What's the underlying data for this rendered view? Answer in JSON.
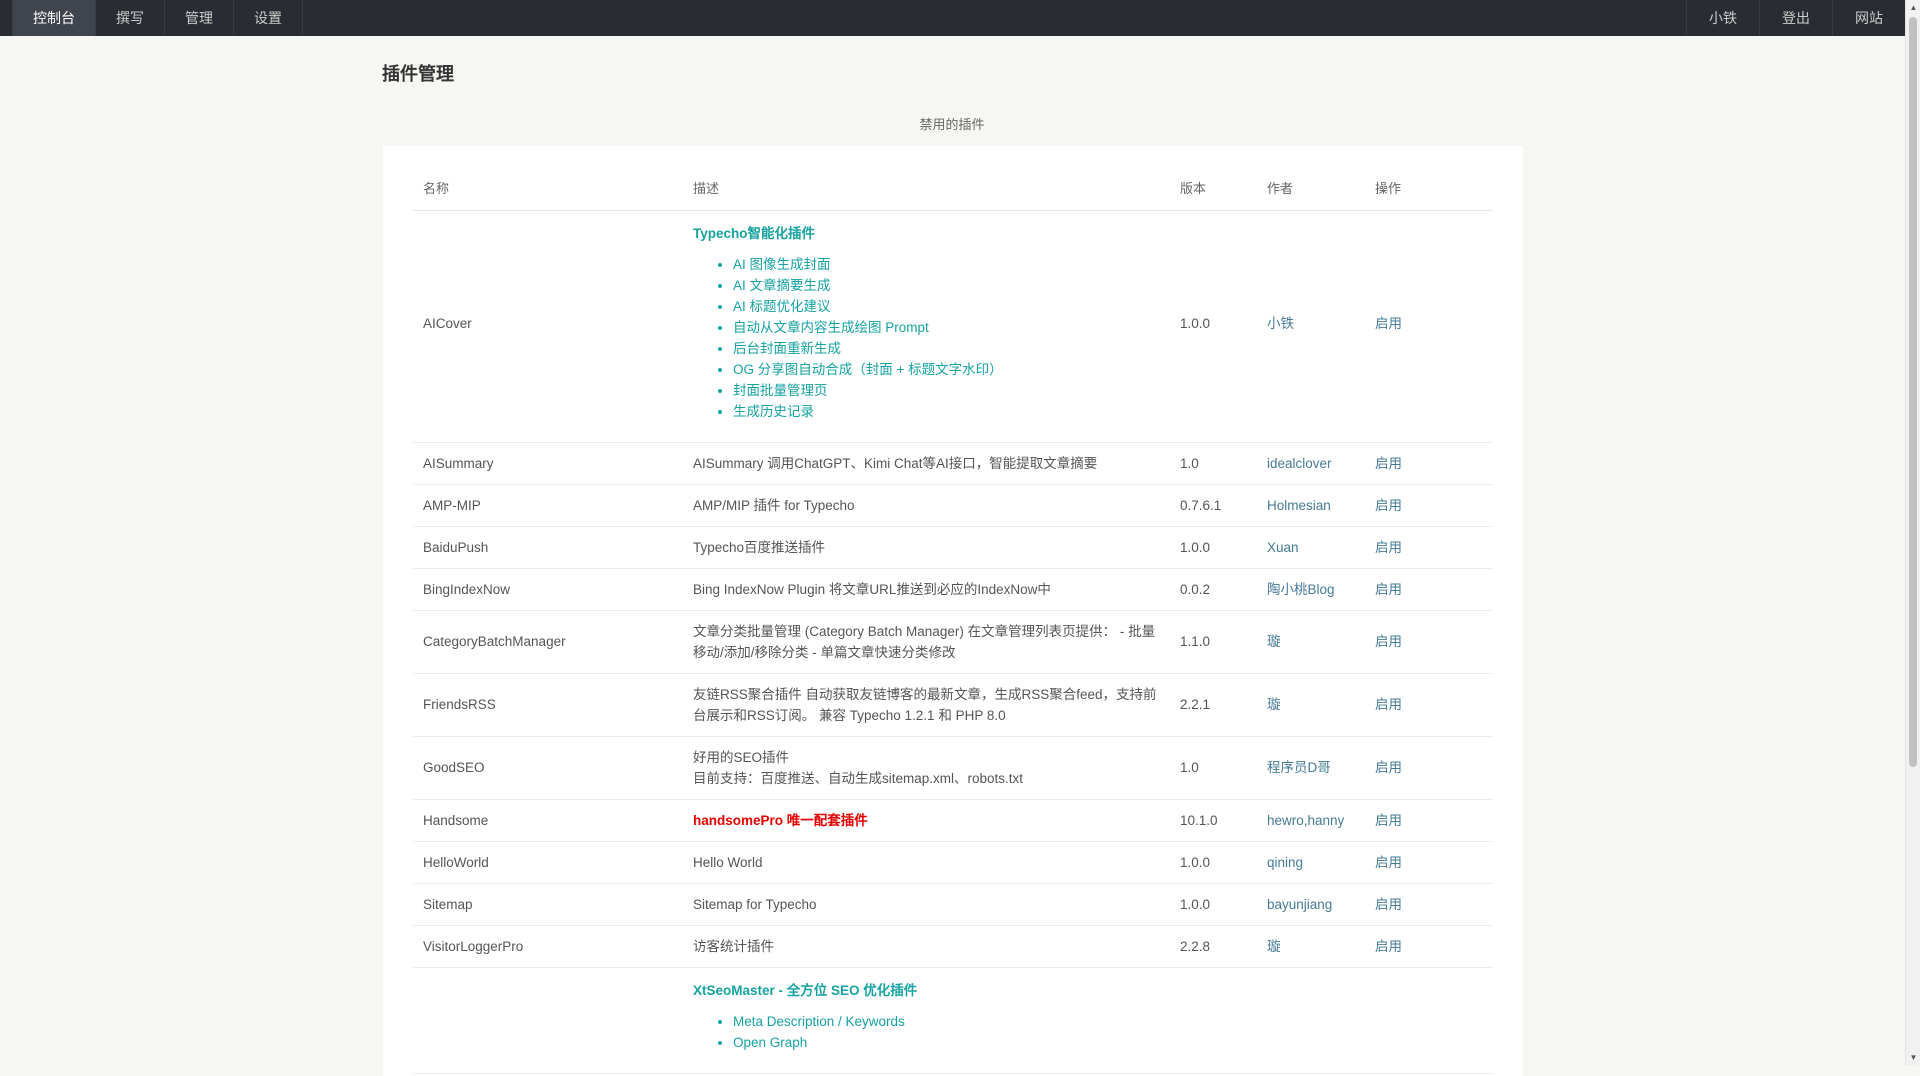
{
  "nav": {
    "left": [
      "控制台",
      "撰写",
      "管理",
      "设置"
    ],
    "right": [
      "小铁",
      "登出",
      "网站"
    ]
  },
  "page_title": "插件管理",
  "section_title": "禁用的插件",
  "table": {
    "headers": [
      "名称",
      "描述",
      "版本",
      "作者",
      "操作"
    ],
    "rows": [
      {
        "name": "AICover",
        "heading": "Typecho智能化插件",
        "features": [
          "AI 图像生成封面",
          "AI 文章摘要生成",
          "AI 标题优化建议",
          "自动从文章内容生成绘图 Prompt",
          "后台封面重新生成",
          "OG 分享图自动合成（封面 + 标题文字水印）",
          "封面批量管理页",
          "生成历史记录"
        ],
        "version": "1.0.0",
        "author": "小铁",
        "action": "启用"
      },
      {
        "name": "AISummary",
        "desc": "AISummary 调用ChatGPT、Kimi Chat等AI接口，智能提取文章摘要",
        "version": "1.0",
        "author": "idealclover",
        "action": "启用"
      },
      {
        "name": "AMP-MIP",
        "desc": "AMP/MIP 插件 for Typecho",
        "version": "0.7.6.1",
        "author": "Holmesian",
        "action": "启用"
      },
      {
        "name": "BaiduPush",
        "desc": "Typecho百度推送插件",
        "version": "1.0.0",
        "author": "Xuan",
        "action": "启用"
      },
      {
        "name": "BingIndexNow",
        "desc": "Bing IndexNow Plugin 将文章URL推送到必应的IndexNow中",
        "version": "0.0.2",
        "author": "陶小桃Blog",
        "action": "启用"
      },
      {
        "name": "CategoryBatchManager",
        "desc": "文章分类批量管理 (Category Batch Manager) 在文章管理列表页提供： - 批量移动/添加/移除分类 - 单篇文章快速分类修改",
        "version": "1.1.0",
        "author": "璇",
        "action": "启用"
      },
      {
        "name": "FriendsRSS",
        "desc": "友链RSS聚合插件 自动获取友链博客的最新文章，生成RSS聚合feed，支持前台展示和RSS订阅。 兼容 Typecho 1.2.1 和 PHP 8.0",
        "version": "2.2.1",
        "author": "璇",
        "action": "启用"
      },
      {
        "name": "GoodSEO",
        "desc_line1": "好用的SEO插件",
        "desc_line2": "目前支持：百度推送、自动生成sitemap.xml、robots.txt",
        "version": "1.0",
        "author": "程序员D哥",
        "action": "启用"
      },
      {
        "name": "Handsome",
        "heading": "handsomePro 唯一配套插件",
        "version": "10.1.0",
        "author": "hewro,hanny",
        "action": "启用"
      },
      {
        "name": "HelloWorld",
        "desc": "Hello World",
        "version": "1.0.0",
        "author": "qining",
        "action": "启用"
      },
      {
        "name": "Sitemap",
        "desc": "Sitemap for Typecho",
        "version": "1.0.0",
        "author": "bayunjiang",
        "action": "启用"
      },
      {
        "name": "VisitorLoggerPro",
        "desc": "访客统计插件",
        "version": "2.2.8",
        "author": "璇",
        "action": "启用"
      },
      {
        "heading": "XtSeoMaster - 全方位 SEO 优化插件",
        "features": [
          "Meta Description / Keywords",
          "Open Graph"
        ]
      }
    ]
  }
}
